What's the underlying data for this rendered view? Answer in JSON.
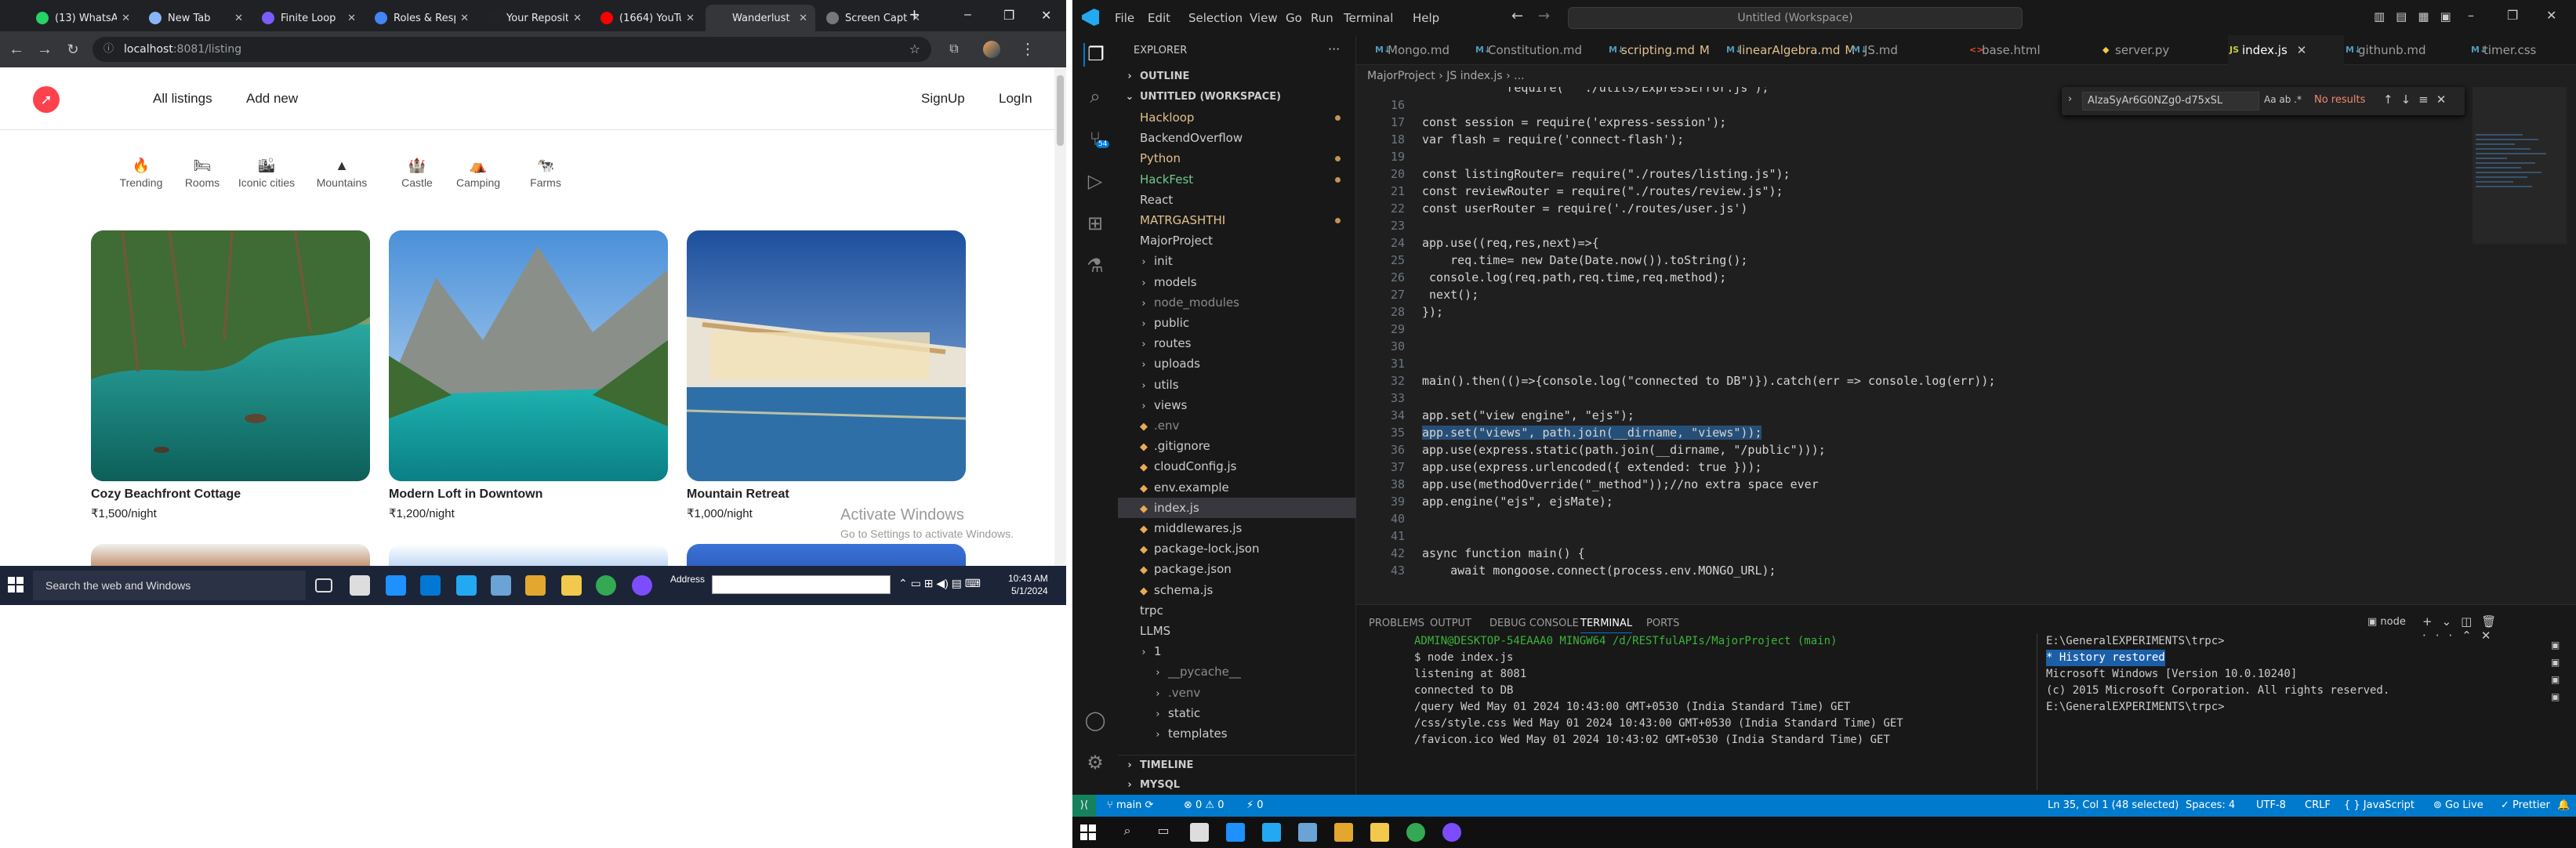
{
  "chrome": {
    "tabs": [
      {
        "label": "(13) WhatsA",
        "color": "#25d366"
      },
      {
        "label": "New Tab",
        "color": "#8ab4f8"
      },
      {
        "label": "Finite Loop",
        "color": "#7b5cff"
      },
      {
        "label": "Roles & Resp",
        "color": "#4285f4"
      },
      {
        "label": "Your Reposit",
        "color": "#222222"
      },
      {
        "label": "(1664) YouTu",
        "color": "#ff0000"
      },
      {
        "label": "Wanderlust",
        "color": "#35363a"
      },
      {
        "label": "Screen Capt",
        "color": "#777777"
      }
    ],
    "address_host": "localhost",
    "address_path": ":8081/listing",
    "window_buttons": [
      "–",
      "❐",
      "✕"
    ]
  },
  "site": {
    "nav": {
      "all_listings": "All listings",
      "add_new": "Add new",
      "signup": "SignUp",
      "login": "LogIn"
    },
    "filters": [
      {
        "icon": "flame-icon",
        "glyph": "🔥",
        "label": "Trending"
      },
      {
        "icon": "bed-icon",
        "glyph": "🛏",
        "label": "Rooms"
      },
      {
        "icon": "city-icon",
        "glyph": "🏙",
        "label": "Iconic cities"
      },
      {
        "icon": "mountain-icon",
        "glyph": "▲",
        "label": "Mountains"
      },
      {
        "icon": "castle-icon",
        "glyph": "🏰",
        "label": "Castle"
      },
      {
        "icon": "campground-icon",
        "glyph": "⛺",
        "label": "Camping"
      },
      {
        "icon": "cow-icon",
        "glyph": "🐄",
        "label": "Farms"
      }
    ],
    "listings": [
      {
        "title": "Cozy Beachfront Cottage",
        "price": "₹1,500/night"
      },
      {
        "title": "Modern Loft in Downtown",
        "price": "₹1,200/night"
      },
      {
        "title": "Mountain Retreat",
        "price": "₹1,000/night"
      }
    ],
    "activate": {
      "title": "Activate Windows",
      "subtitle": "Go to Settings to activate Windows."
    }
  },
  "taskbar_left": {
    "search": "Search the web and Windows",
    "address_label": "Address",
    "time": "10:43 AM",
    "date": "5/1/2024"
  },
  "vscode": {
    "menu": [
      "File",
      "Edit",
      "Selection",
      "View",
      "Go",
      "Run",
      "Terminal",
      "Help"
    ],
    "command_center": "Untitled (Workspace)",
    "explorer_title": "EXPLORER",
    "sections": {
      "outline": "OUTLINE",
      "workspace": "UNTITLED (WORKSPACE)",
      "timeline": "TIMELINE",
      "mysql": "MYSQL"
    },
    "tree": [
      {
        "label": "Hackloop",
        "indent": 0,
        "kind": "folder",
        "color": "#e2c08d",
        "dot": true
      },
      {
        "label": "BackendOverflow",
        "indent": 0,
        "kind": "folder",
        "color": "#cccccc",
        "dot": false
      },
      {
        "label": "Python",
        "indent": 0,
        "kind": "folder",
        "color": "#e2c08d",
        "dot": true
      },
      {
        "label": "HackFest",
        "indent": 0,
        "kind": "folder",
        "color": "#73c991",
        "dot": true
      },
      {
        "label": "React",
        "indent": 0,
        "kind": "folder",
        "color": "#cccccc",
        "dot": false
      },
      {
        "label": "MATRGASHTHI",
        "indent": 0,
        "kind": "folder",
        "color": "#e2c08d",
        "dot": true
      },
      {
        "label": "MajorProject",
        "indent": 0,
        "kind": "folder",
        "color": "#cccccc",
        "dot": false
      },
      {
        "label": "init",
        "indent": 1,
        "kind": "folder",
        "color": "#cccccc",
        "dot": false
      },
      {
        "label": "models",
        "indent": 1,
        "kind": "folder",
        "color": "#cccccc",
        "dot": false
      },
      {
        "label": "node_modules",
        "indent": 1,
        "kind": "folder",
        "color": "#8b8b8b",
        "dot": false
      },
      {
        "label": "public",
        "indent": 1,
        "kind": "folder",
        "color": "#cccccc",
        "dot": false
      },
      {
        "label": "routes",
        "indent": 1,
        "kind": "folder",
        "color": "#cccccc",
        "dot": false
      },
      {
        "label": "uploads",
        "indent": 1,
        "kind": "folder",
        "color": "#cccccc",
        "dot": false
      },
      {
        "label": "utils",
        "indent": 1,
        "kind": "folder",
        "color": "#cccccc",
        "dot": false
      },
      {
        "label": "views",
        "indent": 1,
        "kind": "folder",
        "color": "#cccccc",
        "dot": false
      },
      {
        "label": ".env",
        "indent": 1,
        "kind": "file",
        "color": "#8b8b8b",
        "dot": false
      },
      {
        "label": ".gitignore",
        "indent": 1,
        "kind": "file",
        "color": "#cccccc",
        "dot": false
      },
      {
        "label": "cloudConfig.js",
        "indent": 1,
        "kind": "file",
        "color": "#cccccc",
        "dot": false
      },
      {
        "label": "env.example",
        "indent": 1,
        "kind": "file",
        "color": "#cccccc",
        "dot": false
      },
      {
        "label": "index.js",
        "indent": 1,
        "kind": "file",
        "color": "#cccccc",
        "dot": false,
        "selected": true
      },
      {
        "label": "middlewares.js",
        "indent": 1,
        "kind": "file",
        "color": "#cccccc",
        "dot": false
      },
      {
        "label": "package-lock.json",
        "indent": 1,
        "kind": "file",
        "color": "#cccccc",
        "dot": false
      },
      {
        "label": "package.json",
        "indent": 1,
        "kind": "file",
        "color": "#cccccc",
        "dot": false
      },
      {
        "label": "schema.js",
        "indent": 1,
        "kind": "file",
        "color": "#cccccc",
        "dot": false
      },
      {
        "label": "trpc",
        "indent": 0,
        "kind": "folder",
        "color": "#cccccc",
        "dot": false
      },
      {
        "label": "LLMS",
        "indent": 0,
        "kind": "folder",
        "color": "#cccccc",
        "dot": false
      },
      {
        "label": "1",
        "indent": 1,
        "kind": "folder",
        "color": "#cccccc",
        "dot": false
      },
      {
        "label": "__pycache__",
        "indent": 2,
        "kind": "folder",
        "color": "#8b8b8b",
        "dot": false
      },
      {
        "label": ".venv",
        "indent": 2,
        "kind": "folder",
        "color": "#8b8b8b",
        "dot": false
      },
      {
        "label": "static",
        "indent": 2,
        "kind": "folder",
        "color": "#cccccc",
        "dot": false
      },
      {
        "label": "templates",
        "indent": 2,
        "kind": "folder",
        "color": "#cccccc",
        "dot": false
      }
    ],
    "editor_tabs": [
      {
        "label": "Mongo.md",
        "icon": "markdown-icon",
        "badge": ""
      },
      {
        "label": "Constitution.md",
        "icon": "markdown-icon",
        "badge": ""
      },
      {
        "label": "scripting.md",
        "icon": "markdown-icon",
        "badge": "M"
      },
      {
        "label": "linearAlgebra.md",
        "icon": "markdown-icon",
        "badge": "M"
      },
      {
        "label": "JS.md",
        "icon": "markdown-icon",
        "badge": ""
      },
      {
        "label": "base.html",
        "icon": "html-icon",
        "badge": ""
      },
      {
        "label": "server.py",
        "icon": "python-icon",
        "badge": ""
      },
      {
        "label": "index.js",
        "icon": "javascript-icon",
        "badge": "",
        "active": true
      },
      {
        "label": "githunb.md",
        "icon": "markdown-icon",
        "badge": ""
      },
      {
        "label": "timer.css",
        "icon": "css-icon",
        "badge": ""
      }
    ],
    "breadcrumb": "MajorProject  ›  JS index.js  › ...",
    "find": {
      "query": "AIzaSyAr6G0NZg0-d75xSL",
      "options": "Aa  ab  .*",
      "result": "No results"
    },
    "code_lines": [
      {
        "n": "",
        "text": "            require(   ./utils/ExpressError.js );"
      },
      {
        "n": "16",
        "text": ""
      },
      {
        "n": "17",
        "text": "const session = require('express-session');"
      },
      {
        "n": "18",
        "text": "var flash = require('connect-flash');"
      },
      {
        "n": "19",
        "text": ""
      },
      {
        "n": "20",
        "text": "const listingRouter= require(\"./routes/listing.js\");"
      },
      {
        "n": "21",
        "text": "const reviewRouter = require(\"./routes/review.js\");"
      },
      {
        "n": "22",
        "text": "const userRouter = require('./routes/user.js')"
      },
      {
        "n": "23",
        "text": ""
      },
      {
        "n": "24",
        "text": "app.use((req,res,next)=>{"
      },
      {
        "n": "25",
        "text": "    req.time= new Date(Date.now()).toString();"
      },
      {
        "n": "26",
        "text": " console.log(req.path,req.time,req.method);"
      },
      {
        "n": "27",
        "text": " next();"
      },
      {
        "n": "28",
        "text": "});"
      },
      {
        "n": "29",
        "text": ""
      },
      {
        "n": "30",
        "text": ""
      },
      {
        "n": "31",
        "text": ""
      },
      {
        "n": "32",
        "text": "main().then(()=>{console.log(\"connected to DB\")}).catch(err => console.log(err));"
      },
      {
        "n": "33",
        "text": ""
      },
      {
        "n": "34",
        "text": "app.set(\"view engine\", \"ejs\");"
      },
      {
        "n": "35",
        "text": "app.set(\"views\", path.join(__dirname, \"views\"));"
      },
      {
        "n": "36",
        "text": "app.use(express.static(path.join(__dirname, \"/public\")));"
      },
      {
        "n": "37",
        "text": "app.use(express.urlencoded({ extended: true }));"
      },
      {
        "n": "38",
        "text": "app.use(methodOverride(\"_method\"));//no extra space ever"
      },
      {
        "n": "39",
        "text": "app.engine(\"ejs\", ejsMate);"
      },
      {
        "n": "40",
        "text": ""
      },
      {
        "n": "41",
        "text": ""
      },
      {
        "n": "42",
        "text": "async function main() {"
      },
      {
        "n": "43",
        "text": "    await mongoose.connect(process.env.MONGO_URL);"
      }
    ],
    "panel_tabs": [
      "PROBLEMS",
      "OUTPUT",
      "DEBUG CONSOLE",
      "TERMINAL",
      "PORTS"
    ],
    "panel_active": "TERMINAL",
    "terminal_shell": "node",
    "terminal_left": [
      "",
      "ADMIN@DESKTOP-54EAAA0 MINGW64 /d/RESTfulAPIs/MajorProject (main)",
      "$ node index.js",
      "listening at 8081",
      "connected to DB",
      "/query Wed May 01 2024 10:43:00 GMT+0530 (India Standard Time) GET",
      "/css/style.css Wed May 01 2024 10:43:00 GMT+0530 (India Standard Time) GET",
      "/favicon.ico Wed May 01 2024 10:43:02 GMT+0530 (India Standard Time) GET"
    ],
    "terminal_right": [
      "E:\\GeneralEXPERIMENTS\\trpc>",
      "* History restored",
      "",
      "Microsoft Windows [Version 10.0.10240]",
      "(c) 2015 Microsoft Corporation. All rights reserved.",
      "",
      "E:\\GeneralEXPERIMENTS\\trpc>"
    ],
    "status": {
      "branch": "main",
      "errors": "⊗ 0 ⚠ 0",
      "ports": "⚡ 0",
      "position": "Ln 35, Col 1 (48 selected)",
      "spaces": "Spaces: 4",
      "encoding": "UTF-8",
      "eol": "CRLF",
      "language": "{ } JavaScript",
      "golive": "Go Live",
      "prettier": "✓ Prettier"
    },
    "accent": "#007acc"
  }
}
